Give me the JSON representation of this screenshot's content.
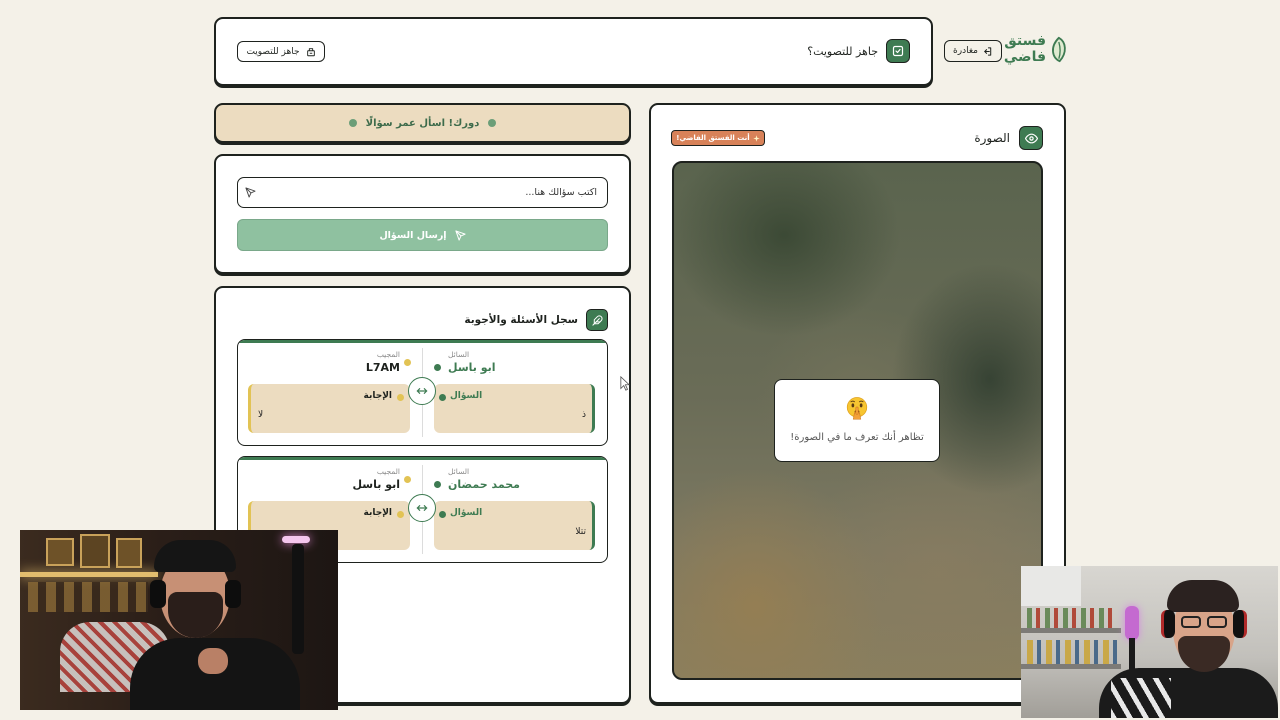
{
  "app": {
    "logo_top": "فستق",
    "logo_bottom": "فاضي",
    "logo_icon": "pistachio-logo-icon",
    "leave_label": "مغادرة",
    "leave_icon": "exit-icon"
  },
  "header": {
    "ready_question": "جاهز للتصويت؟",
    "ready_question_icon": "vote-check-icon",
    "ready_button_label": "جاهز للتصويت",
    "ready_button_icon": "ballot-box-icon"
  },
  "turn_banner": {
    "text": "دورك! اسأل عمر سؤالًا"
  },
  "ask": {
    "value": "",
    "placeholder": "اكتب سؤالك هنا...",
    "input_icon": "send-icon",
    "submit_label": "إرسال السؤال",
    "submit_icon": "send-icon",
    "submit_disabled": true
  },
  "log": {
    "title": "سجل الأسئلة والأجوبة",
    "title_icon": "feather-icon",
    "entries": [
      {
        "asker_label": "السائل",
        "asker": "ابو باسل",
        "answerer_label": "المجيب",
        "answerer": "L7AM",
        "question_label": "السؤال",
        "question": "ذ",
        "answer_label": "الإجابة",
        "answer": "لا"
      },
      {
        "asker_label": "السائل",
        "asker": "محمد حمضان",
        "answerer_label": "المجيب",
        "answerer": "ابو باسل",
        "question_label": "السؤال",
        "question": "تتلا",
        "answer_label": "الإجابة"
      }
    ]
  },
  "image_panel": {
    "title": "الصورة",
    "title_icon": "eye-icon",
    "role_badge": "أنت الفستق الفاضي!",
    "role_badge_icon": "sparkle-icon",
    "image_state": "blurred",
    "overlay_icon": "shushing-face-icon",
    "overlay_text": "تظاهر أنك تعرف ما في الصورة!"
  },
  "colors": {
    "background": "#f4f1e8",
    "brand_green": "#3e7b52",
    "tan": "#ecdcc0",
    "answerer_yellow": "#e2c354",
    "disabled_button_green": "#8fc1a0",
    "badge_orange": "#d88259",
    "border_dark": "#1e221e"
  }
}
